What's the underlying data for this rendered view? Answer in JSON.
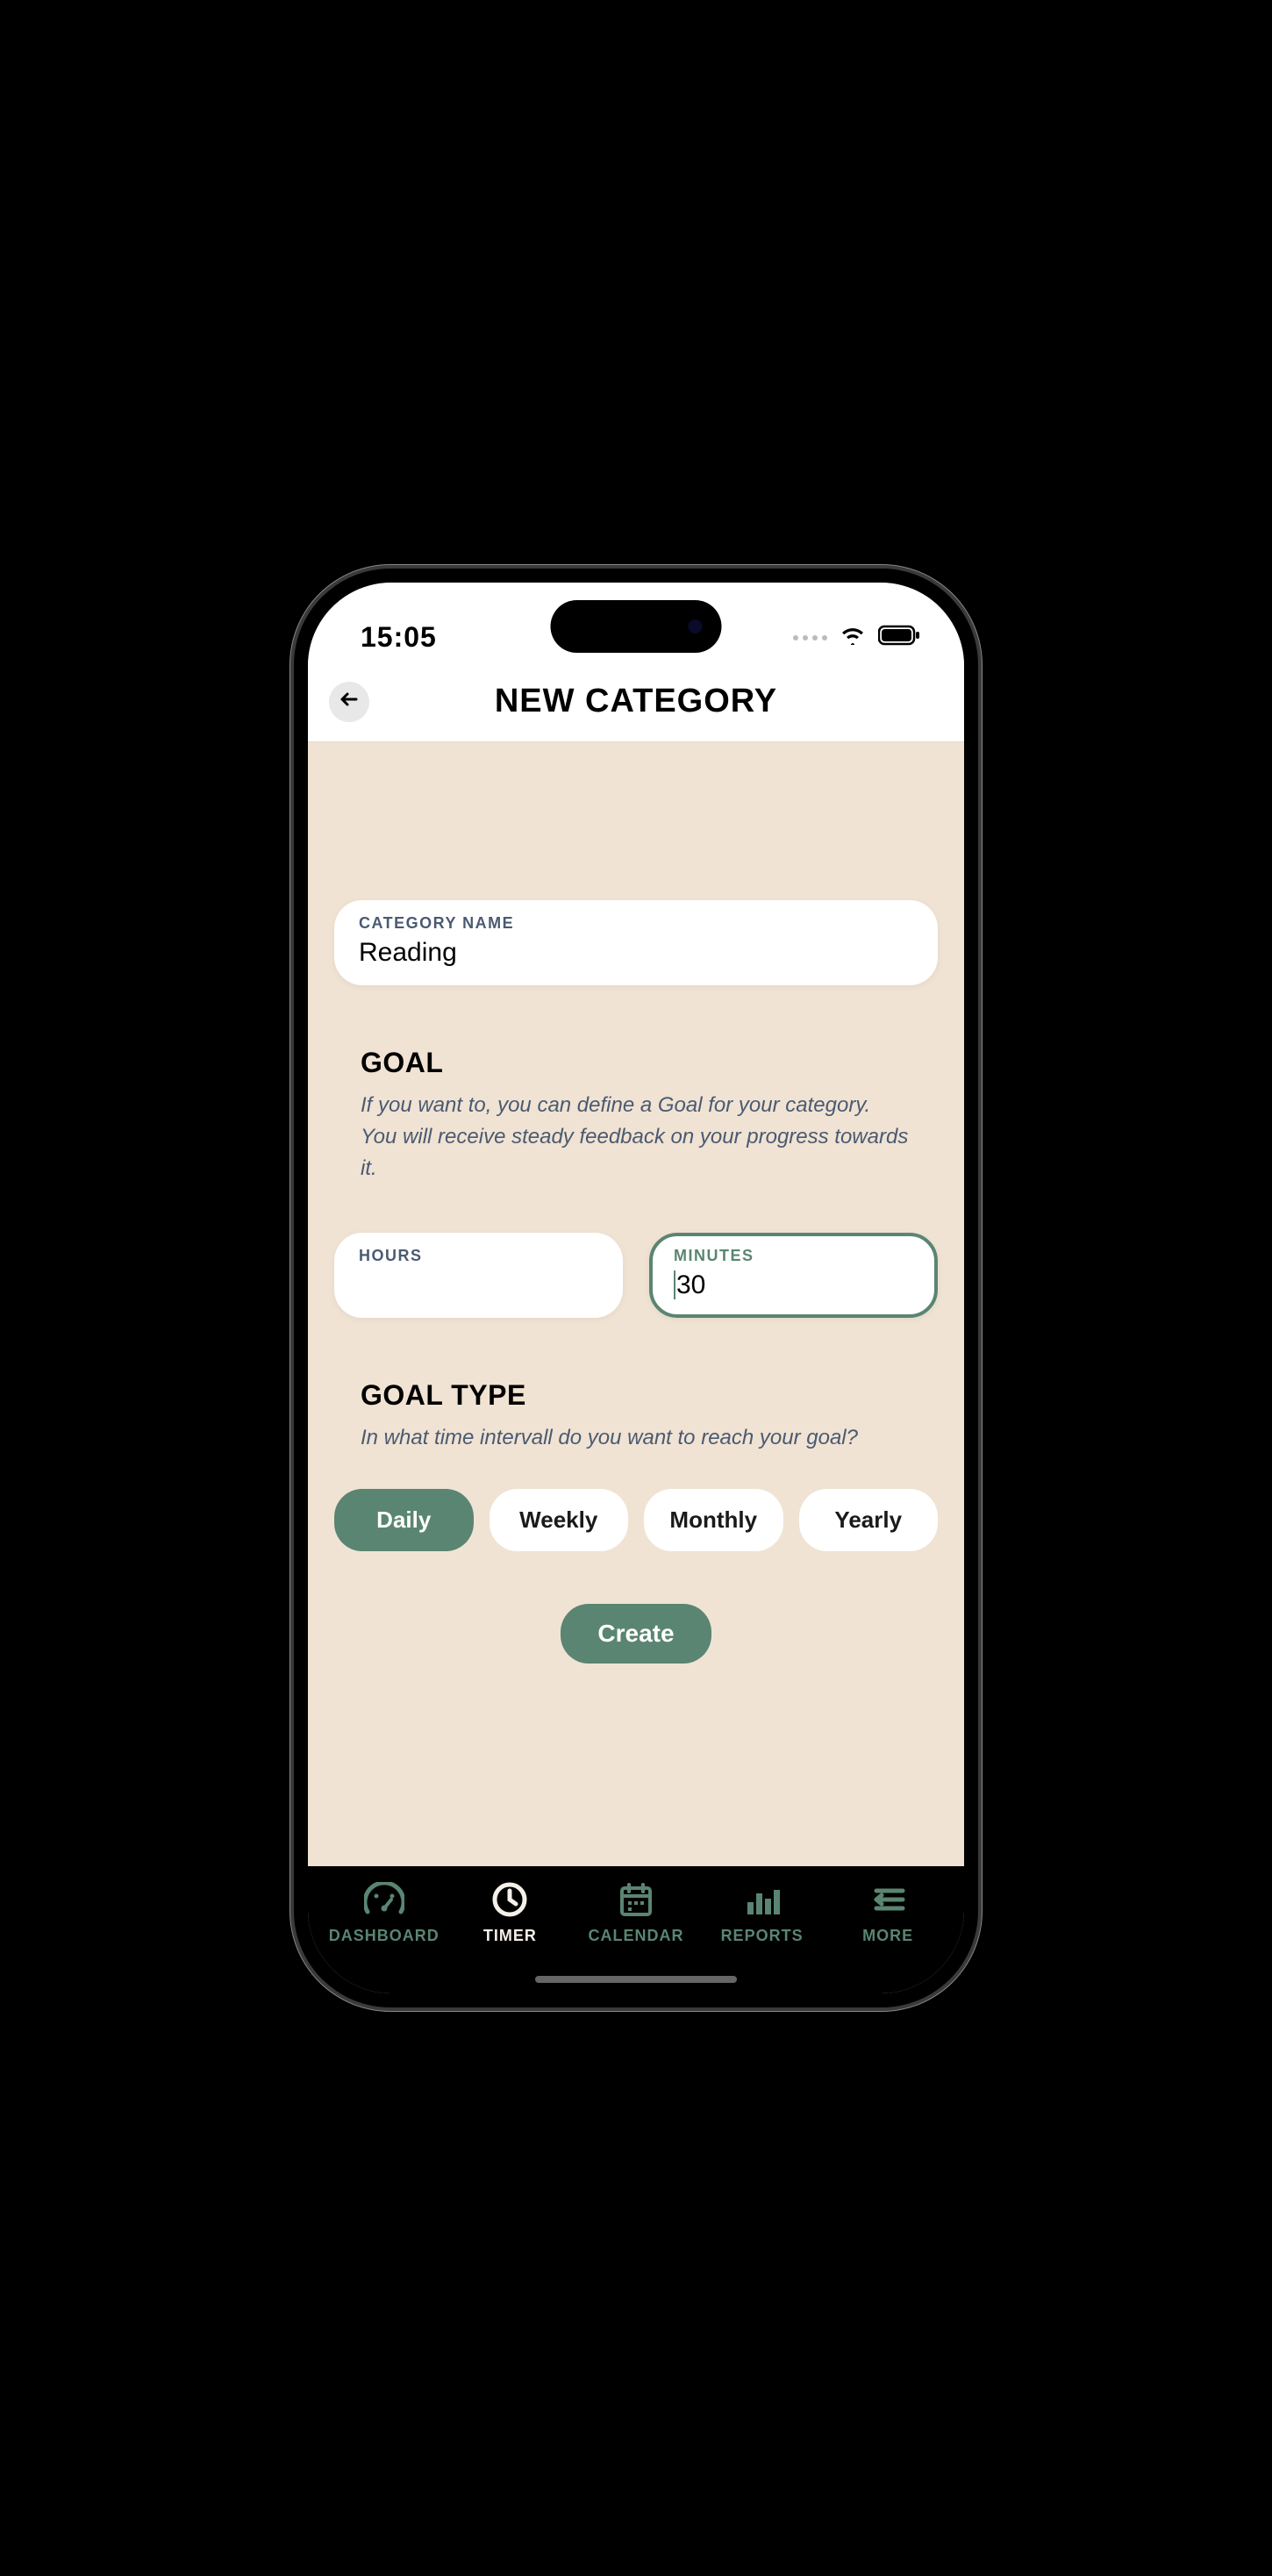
{
  "status": {
    "time": "15:05"
  },
  "header": {
    "title": "NEW CATEGORY"
  },
  "categoryName": {
    "label": "CATEGORY NAME",
    "value": "Reading"
  },
  "goal": {
    "heading": "GOAL",
    "desc": "If you want to, you can define a Goal for your category. You will receive steady feedback on your progress towards it.",
    "hours": {
      "label": "HOURS",
      "value": ""
    },
    "minutes": {
      "label": "MINUTES",
      "value": "30"
    }
  },
  "goalType": {
    "heading": "GOAL TYPE",
    "desc": "In what time intervall do you want to reach your goal?",
    "options": [
      "Daily",
      "Weekly",
      "Monthly",
      "Yearly"
    ],
    "selected": "Daily"
  },
  "createLabel": "Create",
  "tabs": [
    {
      "label": "DASHBOARD",
      "active": false
    },
    {
      "label": "TIMER",
      "active": true
    },
    {
      "label": "CALENDAR",
      "active": false
    },
    {
      "label": "REPORTS",
      "active": false
    },
    {
      "label": "MORE",
      "active": false
    }
  ],
  "colors": {
    "accent": "#5a8572",
    "bg": "#f0e3d3"
  }
}
